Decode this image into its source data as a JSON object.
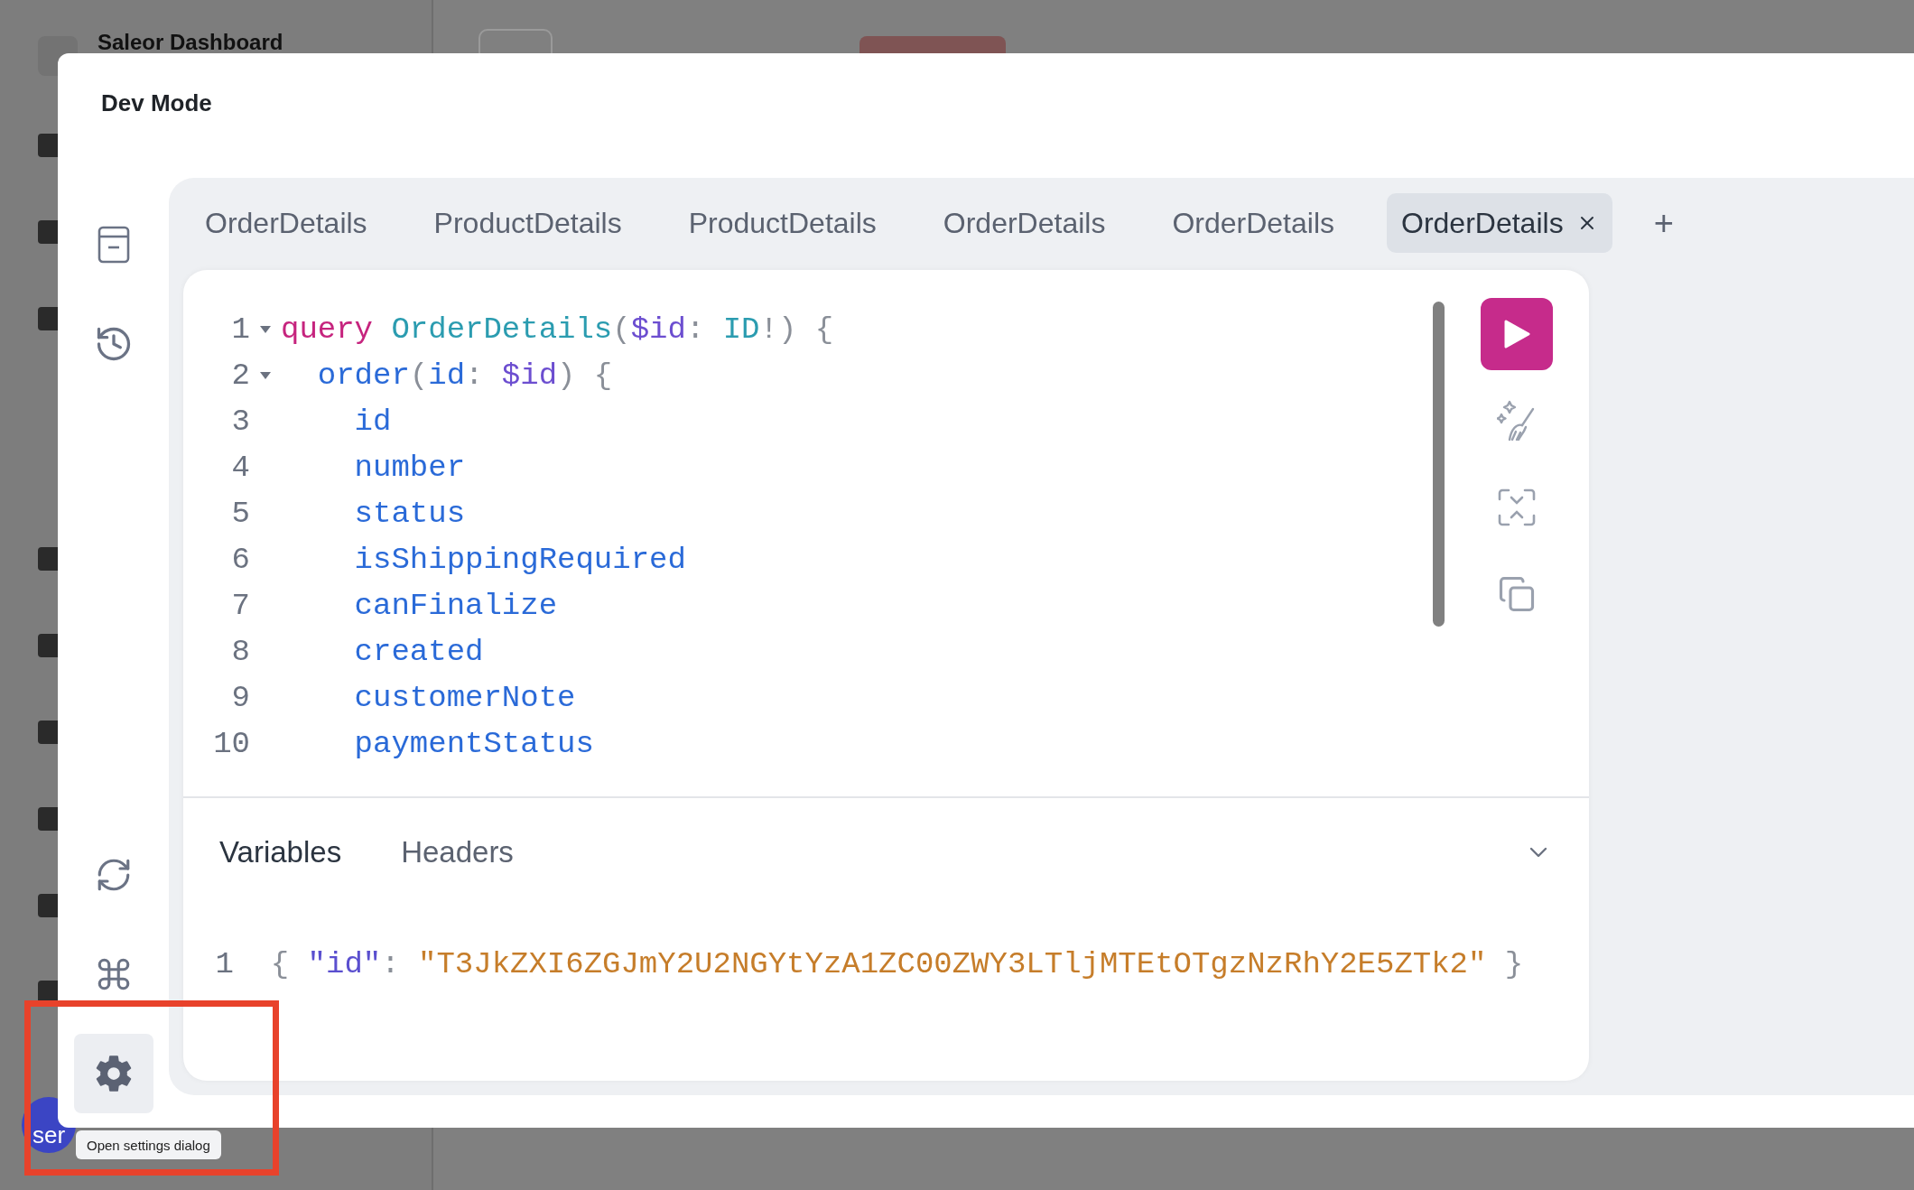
{
  "background": {
    "app_title": "Saleor Dashboard",
    "avatar_text": "ser"
  },
  "dialog": {
    "title": "Dev Mode",
    "side_buttons": [
      {
        "kind": "docs",
        "selected": false
      },
      {
        "kind": "history",
        "selected": false
      },
      {
        "kind": "refresh",
        "selected": false
      },
      {
        "kind": "shortcuts",
        "selected": false
      },
      {
        "kind": "settings",
        "selected": true
      }
    ],
    "tabs": [
      {
        "label": "OrderDetails",
        "selected": false
      },
      {
        "label": "ProductDetails",
        "selected": false
      },
      {
        "label": "ProductDetails",
        "selected": false
      },
      {
        "label": "OrderDetails",
        "selected": false
      },
      {
        "label": "OrderDetails",
        "selected": false
      },
      {
        "label": "OrderDetails",
        "selected": true
      }
    ],
    "add_tab": "+",
    "code_lines": [
      {
        "number": "1",
        "foldable": true,
        "tokens": [
          {
            "kind": "keyword",
            "text": "query"
          },
          {
            "kind": "name",
            "text": "OrderDetails",
            "spaced": true
          },
          {
            "kind": "punct",
            "text": "("
          },
          {
            "kind": "variable",
            "text": "$id"
          },
          {
            "kind": "punct",
            "text": ":"
          },
          {
            "kind": "name",
            "text": "ID",
            "spaced": true
          },
          {
            "kind": "punct",
            "text": "!)"
          },
          {
            "kind": "punct",
            "text": "{",
            "spaced": true
          }
        ],
        "children": [
          {
            "number": "2",
            "foldable": true,
            "tokens": [
              {
                "kind": "field",
                "text": "order"
              },
              {
                "kind": "punct",
                "text": "("
              },
              {
                "kind": "field",
                "text": "id"
              },
              {
                "kind": "punct",
                "text": ":"
              },
              {
                "kind": "variable",
                "text": "$id",
                "spaced": true
              },
              {
                "kind": "punct",
                "text": ")"
              },
              {
                "kind": "punct",
                "text": "{",
                "spaced": true
              }
            ],
            "children": [
              {
                "number": "3",
                "foldable": false,
                "tokens": [
                  {
                    "kind": "field",
                    "text": "id"
                  }
                ]
              },
              {
                "number": "4",
                "foldable": false,
                "tokens": [
                  {
                    "kind": "field",
                    "text": "number"
                  }
                ]
              },
              {
                "number": "5",
                "foldable": false,
                "tokens": [
                  {
                    "kind": "field",
                    "text": "status"
                  }
                ]
              },
              {
                "number": "6",
                "foldable": false,
                "tokens": [
                  {
                    "kind": "field",
                    "text": "isShippingRequired"
                  }
                ]
              },
              {
                "number": "7",
                "foldable": false,
                "tokens": [
                  {
                    "kind": "field",
                    "text": "canFinalize"
                  }
                ]
              },
              {
                "number": "8",
                "foldable": false,
                "tokens": [
                  {
                    "kind": "field",
                    "text": "created"
                  }
                ]
              },
              {
                "number": "9",
                "foldable": false,
                "tokens": [
                  {
                    "kind": "field",
                    "text": "customerNote"
                  }
                ]
              },
              {
                "number": "10",
                "foldable": false,
                "tokens": [
                  {
                    "kind": "field",
                    "text": "paymentStatus"
                  }
                ]
              }
            ]
          }
        ]
      }
    ],
    "bottom_tabs": [
      {
        "label": "Variables",
        "selected": true
      },
      {
        "label": "Headers",
        "selected": false
      }
    ],
    "variable_lines": [
      {
        "number": "1",
        "tokens": [
          {
            "kind": "punct",
            "text": "{"
          },
          {
            "kind": "key",
            "text": "\"id\"",
            "spaced": true
          },
          {
            "kind": "punct",
            "text": ":"
          },
          {
            "kind": "string",
            "text": "\"T3JkZXI6ZGJmY2U2NGYtYzA1ZC00ZWY3LTljMTEtOTgzNzRhY2E5ZTk2\"",
            "spaced": true
          },
          {
            "kind": "punct",
            "text": "}",
            "spaced": true
          }
        ]
      }
    ]
  },
  "tooltip": "Open settings dialog"
}
